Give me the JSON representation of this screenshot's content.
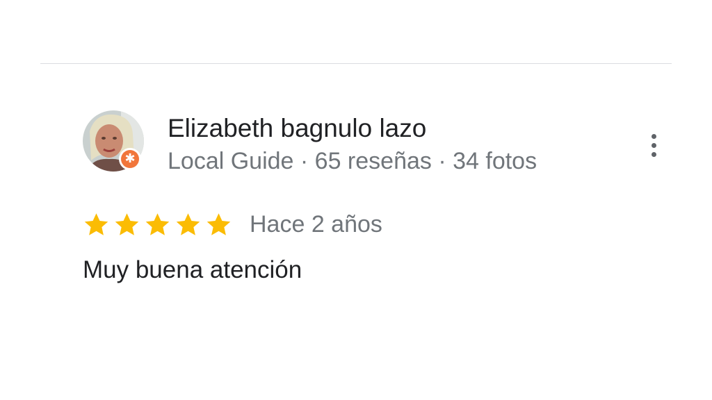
{
  "review": {
    "author": {
      "name": "Elizabeth bagnulo lazo",
      "meta": "Local Guide · 65 reseñas · 34 fotos",
      "badge_icon": "local-guide-badge-icon"
    },
    "rating": {
      "stars": 5,
      "max": 5,
      "time": "Hace 2 años"
    },
    "text": "Muy buena atención",
    "more_icon": "more-vert-icon"
  },
  "colors": {
    "star": "#fbbc04",
    "badge": "#f1763b",
    "primary_text": "#202124",
    "secondary_text": "#70757a",
    "divider": "#dadce0"
  }
}
